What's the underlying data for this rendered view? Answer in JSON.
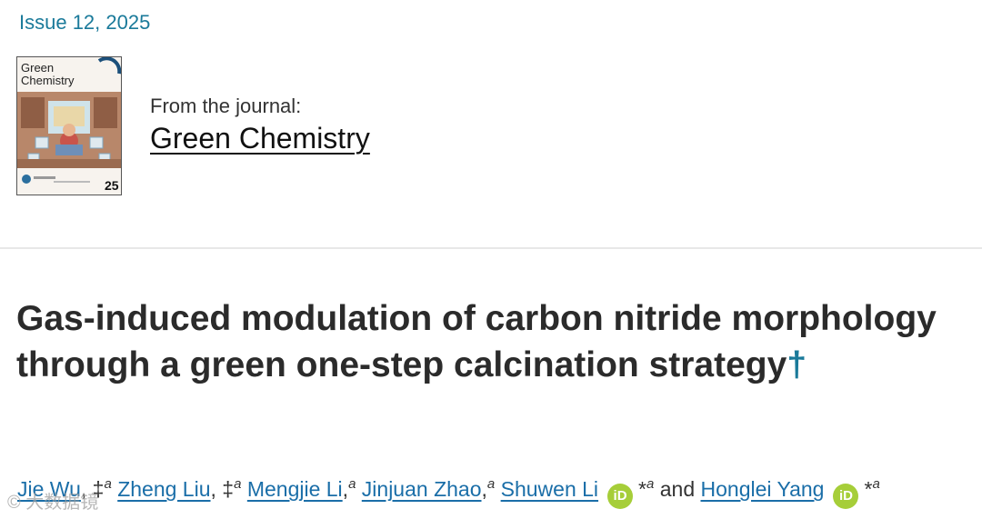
{
  "issue": "Issue 12, 2025",
  "cover": {
    "title_line1": "Green",
    "title_line2": "Chemistry",
    "issue_number": "25"
  },
  "journal": {
    "from_label": "From the journal:",
    "name": "Green Chemistry"
  },
  "article": {
    "title": "Gas-induced modulation of carbon nitride morphology through a green one-step calcination strategy",
    "dagger": "†"
  },
  "authors": [
    {
      "name": "Jie Wu",
      "marks": ", ‡",
      "affil": "a"
    },
    {
      "name": "Zheng Liu",
      "marks": ", ‡",
      "affil": "a"
    },
    {
      "name": "Mengjie Li",
      "marks": ",",
      "affil": "a"
    },
    {
      "name": "Jinjuan Zhao",
      "marks": ",",
      "affil": "a"
    },
    {
      "name": "Shuwen Li",
      "marks": "*",
      "affil": "a",
      "orcid": "iD"
    },
    {
      "name": "Honglei Yang",
      "marks": "*",
      "affil": "a",
      "orcid": "iD"
    }
  ],
  "and_word": "and",
  "watermark": "© 大数据镜"
}
